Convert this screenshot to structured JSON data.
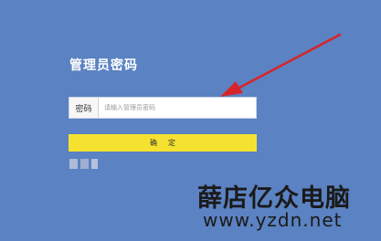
{
  "login": {
    "title": "管理员密码",
    "password_label": "密码",
    "password_placeholder": "请输入管理员密码",
    "password_value": "",
    "confirm_label": "确定"
  },
  "watermark": {
    "site_name": "薛店亿众电脑",
    "url": "www.yzdn.net"
  },
  "colors": {
    "background": "#5b82c2",
    "confirm_button": "#f5e230",
    "arrow": "#d6262b"
  },
  "icons": {
    "language_selector": "blurred-language-icon"
  }
}
